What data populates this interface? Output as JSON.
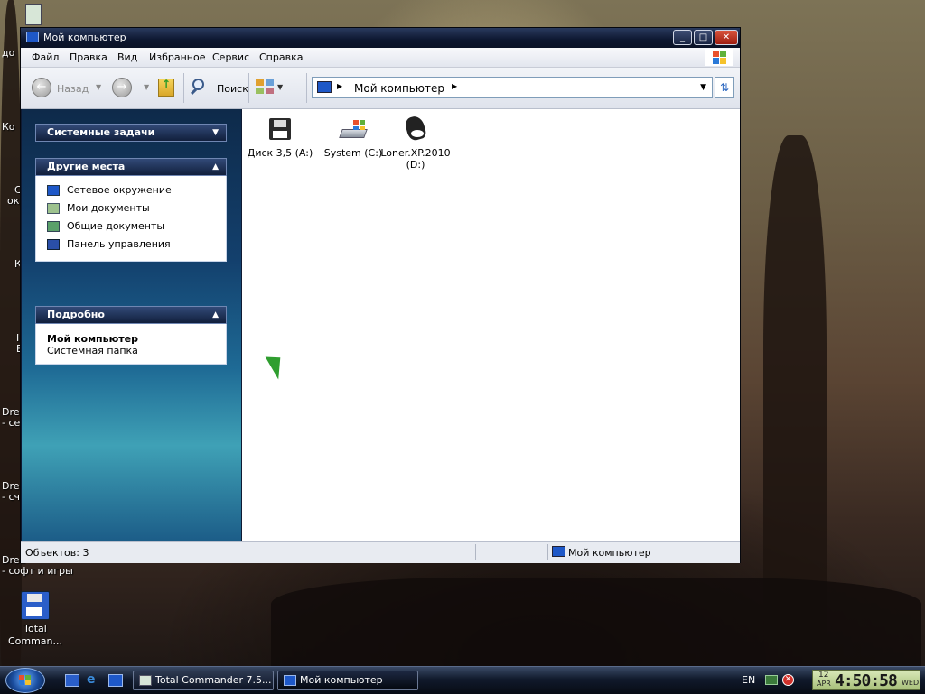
{
  "desktop": {
    "left_texts": [
      "до",
      "Ко",
      "С",
      "ок",
      "К",
      "I",
      "E",
      "Dre",
      "- се",
      "Dre",
      "- сч",
      "Drea",
      "- софт и игры"
    ],
    "icon_label": "Total Comman..."
  },
  "window": {
    "title": "Мой компьютер",
    "controls": {
      "minimize": "_",
      "maximize": "□",
      "close": "✕"
    },
    "menu": [
      "Файл",
      "Правка",
      "Вид",
      "Избранное",
      "Сервис",
      "Справка"
    ],
    "toolbar": {
      "back_label": "Назад",
      "search_label": "Поиск"
    },
    "address": {
      "path": "Мой компьютер"
    },
    "left_panels": {
      "system_tasks": {
        "title": "Системные задачи"
      },
      "other_places": {
        "title": "Другие места",
        "items": [
          "Сетевое окружение",
          "Мои документы",
          "Общие документы",
          "Панель управления"
        ]
      },
      "details": {
        "title": "Подробно",
        "name": "Мой компьютер",
        "type": "Системная папка"
      }
    },
    "drives": [
      {
        "label": "Диск 3,5 (A:)",
        "icon": "floppy-icon"
      },
      {
        "label": "System (C:)",
        "icon": "hard-drive-icon"
      },
      {
        "label": "Loner.XP.2010 (D:)",
        "icon": "dvd-drive-icon"
      }
    ],
    "status": {
      "objects": "Объектов: 3",
      "location": "Мой компьютер"
    }
  },
  "taskbar": {
    "tasks": [
      {
        "label": "Total Commander 7.5..."
      },
      {
        "label": "Мой компьютер"
      }
    ],
    "language": "EN",
    "clock": {
      "day": "12",
      "month": "APR",
      "time": "4:50:58",
      "weekday": "WED"
    }
  },
  "colors": {
    "accent": "#1e58c8",
    "titlebar": "#0d1730",
    "close_button": "#c2402a"
  }
}
